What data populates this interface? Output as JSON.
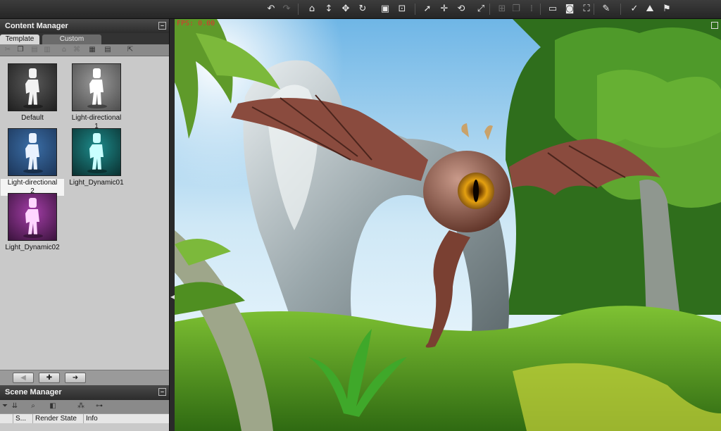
{
  "toolbar": {
    "buttons": [
      {
        "icon": "undo-icon",
        "glyph": "↶",
        "enabled": true
      },
      {
        "icon": "redo-icon",
        "glyph": "↷",
        "enabled": false
      },
      {
        "icon": "home-icon",
        "glyph": "⌂",
        "enabled": true
      },
      {
        "icon": "vertical-move-icon",
        "glyph": "↕",
        "enabled": true
      },
      {
        "icon": "move-icon",
        "glyph": "✥",
        "enabled": true
      },
      {
        "icon": "rotate-icon",
        "glyph": "↻",
        "enabled": true
      },
      {
        "icon": "cube-icon",
        "glyph": "▣",
        "enabled": true
      },
      {
        "icon": "fit-view-icon",
        "glyph": "⊡",
        "enabled": true
      },
      {
        "icon": "select-icon",
        "glyph": "➚",
        "enabled": true
      },
      {
        "icon": "transform-icon",
        "glyph": "✛",
        "enabled": true
      },
      {
        "icon": "orbit-icon",
        "glyph": "⟲",
        "enabled": true
      },
      {
        "icon": "scale-icon",
        "glyph": "⤢",
        "enabled": true
      },
      {
        "icon": "align-icon",
        "glyph": "⊞",
        "enabled": false
      },
      {
        "icon": "copy-icon",
        "glyph": "❐",
        "enabled": false
      },
      {
        "icon": "distribute-icon",
        "glyph": "⁞",
        "enabled": false
      },
      {
        "icon": "window-icon",
        "glyph": "▭",
        "enabled": true
      },
      {
        "icon": "camera-icon",
        "glyph": "◙",
        "enabled": true
      },
      {
        "icon": "fullscreen-icon",
        "glyph": "⛶",
        "enabled": true
      },
      {
        "icon": "brush-icon",
        "glyph": "✎",
        "enabled": true
      },
      {
        "icon": "check-icon",
        "glyph": "✓",
        "enabled": true
      },
      {
        "icon": "terrain-icon",
        "glyph": "⛰",
        "enabled": true
      },
      {
        "icon": "flag-icon",
        "glyph": "⚑",
        "enabled": true
      }
    ]
  },
  "content_manager": {
    "title": "Content Manager",
    "tabs": [
      {
        "label": "Template",
        "active": true
      },
      {
        "label": "Custom",
        "active": false
      }
    ],
    "tools": [
      {
        "icon": "cut-icon",
        "glyph": "✂",
        "enabled": false
      },
      {
        "icon": "copy-icon",
        "glyph": "❐",
        "enabled": true
      },
      {
        "icon": "paste-icon",
        "glyph": "▤",
        "enabled": false
      },
      {
        "icon": "delete-icon",
        "glyph": "▥",
        "enabled": false
      },
      {
        "icon": "home-icon",
        "glyph": "⌂",
        "enabled": false
      },
      {
        "icon": "new-folder-icon",
        "glyph": "⌘",
        "enabled": false
      },
      {
        "icon": "save-icon",
        "glyph": "▦",
        "enabled": true
      },
      {
        "icon": "view-mode-icon",
        "glyph": "▤",
        "enabled": true
      },
      {
        "icon": "export-icon",
        "glyph": "⇱",
        "enabled": true
      }
    ],
    "templates": [
      {
        "name": "Default",
        "label_lines": [
          "Default"
        ],
        "bg": "#5a5a5a",
        "bg2": "#1f1f1f",
        "figure": "#f2f2f2",
        "selected": false
      },
      {
        "name": "Light-directional 1",
        "label_lines": [
          "Light-directional",
          "1"
        ],
        "bg": "#9a9a9a",
        "bg2": "#4d4d4d",
        "figure": "#ffffff",
        "selected": false
      },
      {
        "name": "Light-directional 2",
        "label_lines": [
          "Light-directional",
          "2"
        ],
        "bg": "#3b6fa8",
        "bg2": "#1c3558",
        "figure": "#e9f2ff",
        "selected": true
      },
      {
        "name": "Light_Dynamic01",
        "label_lines": [
          "Light_Dynamic01"
        ],
        "bg": "#1d8c8c",
        "bg2": "#0b3030",
        "figure": "#c9ffff",
        "selected": false
      },
      {
        "name": "Light_Dynamic02",
        "label_lines": [
          "Light_Dynamic02"
        ],
        "bg": "#a43ea8",
        "bg2": "#3a133c",
        "figure": "#ffd6ff",
        "selected": false
      }
    ],
    "nav": [
      {
        "icon": "back-icon",
        "glyph": "◀",
        "enabled": false
      },
      {
        "icon": "add-icon",
        "glyph": "✚",
        "enabled": true
      },
      {
        "icon": "forward-icon",
        "glyph": "➜",
        "enabled": true
      }
    ]
  },
  "scene_manager": {
    "title": "Scene Manager",
    "tools": [
      {
        "icon": "filter-icon",
        "glyph": "⏷"
      },
      {
        "icon": "sort-icon",
        "glyph": "⇊"
      },
      {
        "icon": "find-icon",
        "glyph": "⌕"
      },
      {
        "icon": "columns-icon",
        "glyph": "◧"
      },
      {
        "icon": "group-icon",
        "glyph": "⁂"
      },
      {
        "icon": "hierarchy-icon",
        "glyph": "⊶"
      }
    ],
    "columns": [
      "S...",
      "Render State",
      "Info"
    ]
  },
  "viewport": {
    "fps_text": "FPS: 0.00"
  }
}
